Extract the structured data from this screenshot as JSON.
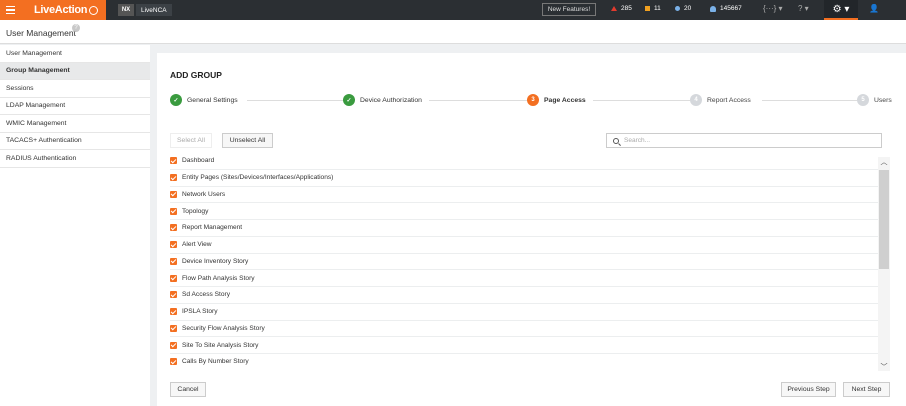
{
  "topbar": {
    "brand": "LiveAction",
    "nx_badge": "NX",
    "product": "LiveNCA",
    "new_features": "New Features!",
    "alerts": [
      {
        "icon": "critical-triangle-icon",
        "count": "285",
        "color": "#e23b2e"
      },
      {
        "icon": "warning-square-icon",
        "count": "11",
        "color": "#f0a020"
      },
      {
        "icon": "info-circle-icon",
        "count": "20",
        "color": "#7ab1e8"
      },
      {
        "icon": "bell-icon",
        "count": "145667",
        "color": "#7ab1e8"
      }
    ],
    "accent": "#f36f21"
  },
  "page": {
    "title": "User Management",
    "help": "?"
  },
  "sidebar": {
    "items": [
      {
        "label": "User Management",
        "active": false
      },
      {
        "label": "Group Management",
        "active": true
      },
      {
        "label": "Sessions",
        "active": false
      },
      {
        "label": "LDAP Management",
        "active": false
      },
      {
        "label": "WMIC Management",
        "active": false
      },
      {
        "label": "TACACS+ Authentication",
        "active": false
      },
      {
        "label": "RADIUS Authentication",
        "active": false
      }
    ]
  },
  "card": {
    "title": "ADD GROUP",
    "steps": [
      {
        "num": "1",
        "label": "General Settings",
        "state": "done"
      },
      {
        "num": "2",
        "label": "Device Authorization",
        "state": "done"
      },
      {
        "num": "3",
        "label": "Page Access",
        "state": "current"
      },
      {
        "num": "4",
        "label": "Report Access",
        "state": "todo"
      },
      {
        "num": "5",
        "label": "Users",
        "state": "todo"
      }
    ],
    "select_all": "Select All",
    "unselect_all": "Unselect All",
    "search_placeholder": "Search...",
    "pages": [
      {
        "label": "Dashboard",
        "checked": true
      },
      {
        "label": "Entity Pages (Sites/Devices/Interfaces/Applications)",
        "checked": true
      },
      {
        "label": "Network Users",
        "checked": true
      },
      {
        "label": "Topology",
        "checked": true
      },
      {
        "label": "Report Management",
        "checked": true
      },
      {
        "label": "Alert View",
        "checked": true
      },
      {
        "label": "Device Inventory Story",
        "checked": true
      },
      {
        "label": "Flow Path Analysis Story",
        "checked": true
      },
      {
        "label": "Sd Access Story",
        "checked": true
      },
      {
        "label": "IPSLA Story",
        "checked": true
      },
      {
        "label": "Security Flow Analysis Story",
        "checked": true
      },
      {
        "label": "Site To Site Analysis Story",
        "checked": true
      },
      {
        "label": "Calls By Number Story",
        "checked": true
      }
    ],
    "cancel": "Cancel",
    "previous": "Previous Step",
    "next": "Next Step"
  }
}
